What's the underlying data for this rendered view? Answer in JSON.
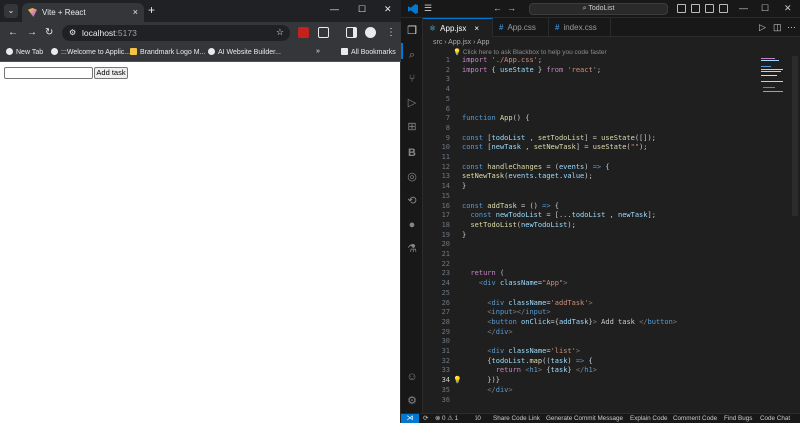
{
  "browser": {
    "tab": {
      "title": "Vite + React",
      "close": "×"
    },
    "new_tab": "+",
    "window": {
      "minimize": "—",
      "maximize": "☐",
      "close": "✕"
    },
    "nav": {
      "back": "←",
      "forward": "→",
      "reload": "↻"
    },
    "omnibox": {
      "host": "localhost",
      "port": ":5173",
      "star": "☆"
    },
    "bookmarks": [
      "New Tab",
      ":::Welcome to Applic...",
      "Brandmark Logo M...",
      "AI Website Builder..."
    ],
    "bookmarks_more": "»",
    "all_bookmarks": "All Bookmarks",
    "page": {
      "input_value": "",
      "add_button": "Add task"
    }
  },
  "vscode": {
    "search_text": "TodoList",
    "tabs": [
      {
        "label": "App.jsx",
        "active": true,
        "close": "×"
      },
      {
        "label": "App.css",
        "active": false,
        "close": ""
      },
      {
        "label": "index.css",
        "active": false,
        "close": ""
      }
    ],
    "breadcrumb": "src  ›  App.jsx  ›  App",
    "hint": "Click here to ask Blackbox to help you code faster",
    "status": {
      "problems": "⊗ 0 ⚠ 1",
      "ports": "⟟0",
      "items": [
        "Share Code Link",
        "Generate Commit Message",
        "Explain Code",
        "Comment Code",
        "Find Bugs",
        "Code Chat"
      ]
    },
    "accent": "#0078d4"
  }
}
